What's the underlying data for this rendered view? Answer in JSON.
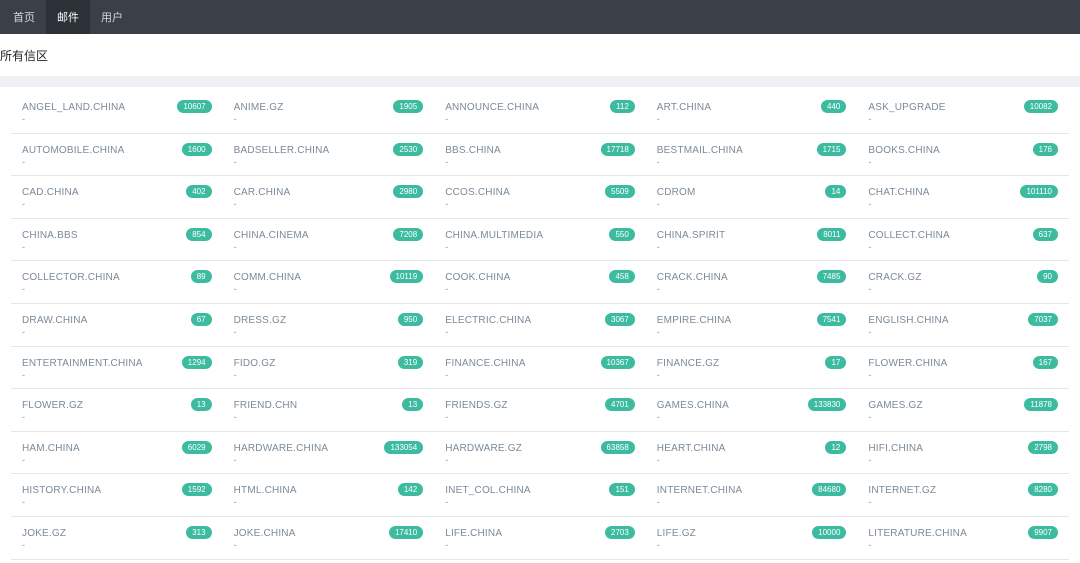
{
  "nav": {
    "items": [
      {
        "label": "首页",
        "active": false
      },
      {
        "label": "邮件",
        "active": true
      },
      {
        "label": "用户",
        "active": false
      }
    ]
  },
  "page": {
    "title": "所有信区"
  },
  "colors": {
    "nav_bg": "#3a3f48",
    "badge": "#3dbba0"
  },
  "boards": [
    {
      "name": "ANGEL_LAND.CHINA",
      "count": "10607",
      "desc": "-"
    },
    {
      "name": "ANIME.GZ",
      "count": "1905",
      "desc": "-"
    },
    {
      "name": "ANNOUNCE.CHINA",
      "count": "112",
      "desc": "-"
    },
    {
      "name": "ART.CHINA",
      "count": "440",
      "desc": "-"
    },
    {
      "name": "ASK_UPGRADE",
      "count": "10082",
      "desc": "-"
    },
    {
      "name": "AUTOMOBILE.CHINA",
      "count": "1600",
      "desc": "-"
    },
    {
      "name": "BADSELLER.CHINA",
      "count": "2530",
      "desc": "-"
    },
    {
      "name": "BBS.CHINA",
      "count": "17718",
      "desc": "-"
    },
    {
      "name": "BESTMAIL.CHINA",
      "count": "1715",
      "desc": "-"
    },
    {
      "name": "BOOKS.CHINA",
      "count": "176",
      "desc": "-"
    },
    {
      "name": "CAD.CHINA",
      "count": "402",
      "desc": "-"
    },
    {
      "name": "CAR.CHINA",
      "count": "2980",
      "desc": "-"
    },
    {
      "name": "CCOS.CHINA",
      "count": "5509",
      "desc": "-"
    },
    {
      "name": "CDROM",
      "count": "14",
      "desc": "-"
    },
    {
      "name": "CHAT.CHINA",
      "count": "101110",
      "desc": "-"
    },
    {
      "name": "CHINA.BBS",
      "count": "854",
      "desc": "-"
    },
    {
      "name": "CHINA.CINEMA",
      "count": "7208",
      "desc": "-"
    },
    {
      "name": "CHINA.MULTIMEDIA",
      "count": "550",
      "desc": "-"
    },
    {
      "name": "CHINA.SPIRIT",
      "count": "8011",
      "desc": "-"
    },
    {
      "name": "COLLECT.CHINA",
      "count": "637",
      "desc": "-"
    },
    {
      "name": "COLLECTOR.CHINA",
      "count": "89",
      "desc": "-"
    },
    {
      "name": "COMM.CHINA",
      "count": "10119",
      "desc": "-"
    },
    {
      "name": "COOK.CHINA",
      "count": "458",
      "desc": "-"
    },
    {
      "name": "CRACK.CHINA",
      "count": "7485",
      "desc": "-"
    },
    {
      "name": "CRACK.GZ",
      "count": "90",
      "desc": "-"
    },
    {
      "name": "DRAW.CHINA",
      "count": "67",
      "desc": "-"
    },
    {
      "name": "DRESS.GZ",
      "count": "950",
      "desc": "-"
    },
    {
      "name": "ELECTRIC.CHINA",
      "count": "3067",
      "desc": "-"
    },
    {
      "name": "EMPIRE.CHINA",
      "count": "7541",
      "desc": "-"
    },
    {
      "name": "ENGLISH.CHINA",
      "count": "7037",
      "desc": "-"
    },
    {
      "name": "ENTERTAINMENT.CHINA",
      "count": "1294",
      "desc": "-"
    },
    {
      "name": "FIDO.GZ",
      "count": "319",
      "desc": "-"
    },
    {
      "name": "FINANCE.CHINA",
      "count": "10367",
      "desc": "-"
    },
    {
      "name": "FINANCE.GZ",
      "count": "17",
      "desc": "-"
    },
    {
      "name": "FLOWER.CHINA",
      "count": "167",
      "desc": "-"
    },
    {
      "name": "FLOWER.GZ",
      "count": "13",
      "desc": "-"
    },
    {
      "name": "FRIEND.CHN",
      "count": "13",
      "desc": "-"
    },
    {
      "name": "FRIENDS.GZ",
      "count": "4701",
      "desc": "-"
    },
    {
      "name": "GAMES.CHINA",
      "count": "133830",
      "desc": "-"
    },
    {
      "name": "GAMES.GZ",
      "count": "11878",
      "desc": "-"
    },
    {
      "name": "HAM.CHINA",
      "count": "6029",
      "desc": "-"
    },
    {
      "name": "HARDWARE.CHINA",
      "count": "133054",
      "desc": "-"
    },
    {
      "name": "HARDWARE.GZ",
      "count": "63858",
      "desc": "-"
    },
    {
      "name": "HEART.CHINA",
      "count": "12",
      "desc": "-"
    },
    {
      "name": "HIFI.CHINA",
      "count": "2798",
      "desc": "-"
    },
    {
      "name": "HISTORY.CHINA",
      "count": "1592",
      "desc": "-"
    },
    {
      "name": "HTML.CHINA",
      "count": "142",
      "desc": "-"
    },
    {
      "name": "INET_COL.CHINA",
      "count": "151",
      "desc": "-"
    },
    {
      "name": "INTERNET.CHINA",
      "count": "84680",
      "desc": "-"
    },
    {
      "name": "INTERNET.GZ",
      "count": "8280",
      "desc": "-"
    },
    {
      "name": "JOKE.GZ",
      "count": "313",
      "desc": "-"
    },
    {
      "name": "JOKE.CHINA",
      "count": "17410",
      "desc": "-"
    },
    {
      "name": "LIFE.CHINA",
      "count": "2703",
      "desc": "-"
    },
    {
      "name": "LIFE.GZ",
      "count": "10000",
      "desc": "-"
    },
    {
      "name": "LITERATURE.CHINA",
      "count": "9907",
      "desc": "-"
    }
  ]
}
